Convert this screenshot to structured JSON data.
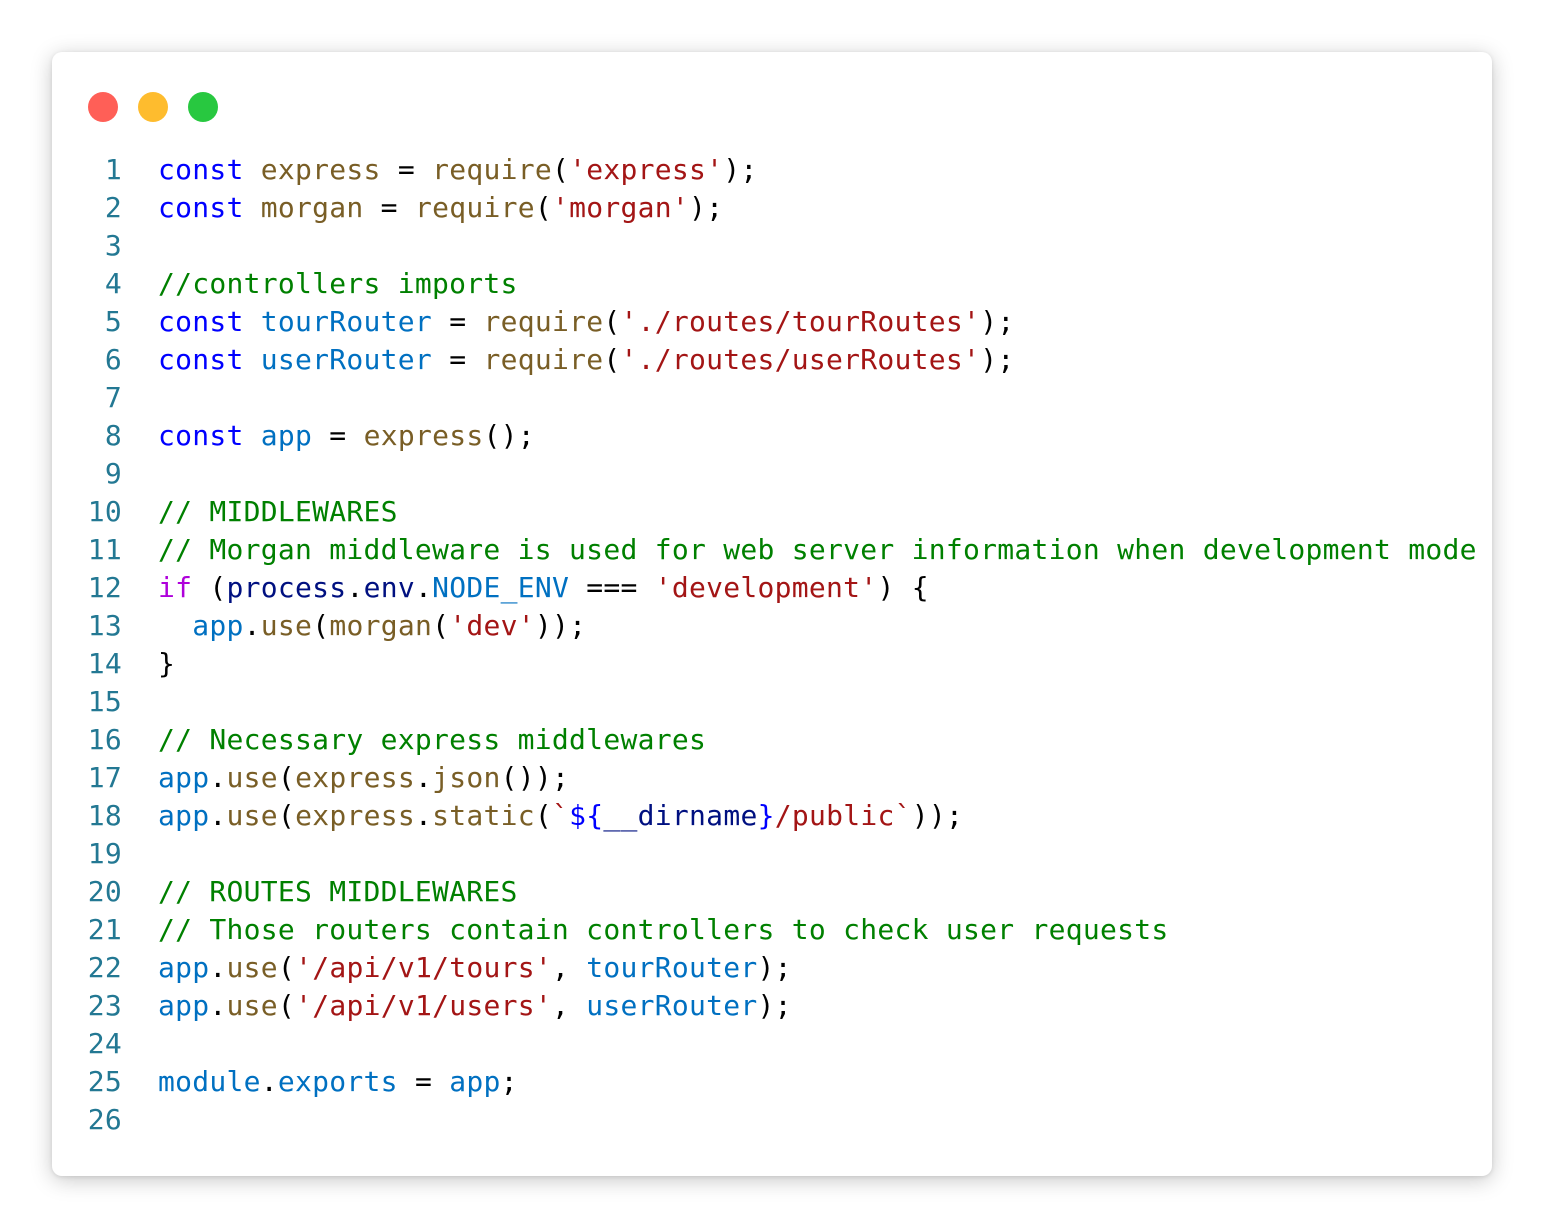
{
  "window": {
    "controls": {
      "close_color": "#ff5f57",
      "minimize_color": "#febc2e",
      "maximize_color": "#28c840"
    }
  },
  "editor": {
    "language": "javascript",
    "colors": {
      "line_number": "#237893",
      "keyword": "#0000ff",
      "control": "#af00db",
      "function": "#795e26",
      "string": "#a31515",
      "variable": "#001080",
      "identifier": "#0070c1",
      "comment": "#008000"
    },
    "lines": [
      {
        "number": "1",
        "tokens": [
          [
            "kw",
            "const"
          ],
          [
            "punc",
            " "
          ],
          [
            "fn",
            "express"
          ],
          [
            "punc",
            " = "
          ],
          [
            "fn",
            "require"
          ],
          [
            "punc",
            "("
          ],
          [
            "str",
            "'express'"
          ],
          [
            "punc",
            ");"
          ]
        ]
      },
      {
        "number": "2",
        "tokens": [
          [
            "kw",
            "const"
          ],
          [
            "punc",
            " "
          ],
          [
            "fn",
            "morgan"
          ],
          [
            "punc",
            " = "
          ],
          [
            "fn",
            "require"
          ],
          [
            "punc",
            "("
          ],
          [
            "str",
            "'morgan'"
          ],
          [
            "punc",
            ");"
          ]
        ]
      },
      {
        "number": "3",
        "tokens": []
      },
      {
        "number": "4",
        "tokens": [
          [
            "cm",
            "//controllers imports"
          ]
        ]
      },
      {
        "number": "5",
        "tokens": [
          [
            "kw",
            "const"
          ],
          [
            "punc",
            " "
          ],
          [
            "id",
            "tourRouter"
          ],
          [
            "punc",
            " = "
          ],
          [
            "fn",
            "require"
          ],
          [
            "punc",
            "("
          ],
          [
            "str",
            "'./routes/tourRoutes'"
          ],
          [
            "punc",
            ");"
          ]
        ]
      },
      {
        "number": "6",
        "tokens": [
          [
            "kw",
            "const"
          ],
          [
            "punc",
            " "
          ],
          [
            "id",
            "userRouter"
          ],
          [
            "punc",
            " = "
          ],
          [
            "fn",
            "require"
          ],
          [
            "punc",
            "("
          ],
          [
            "str",
            "'./routes/userRoutes'"
          ],
          [
            "punc",
            ");"
          ]
        ]
      },
      {
        "number": "7",
        "tokens": []
      },
      {
        "number": "8",
        "tokens": [
          [
            "kw",
            "const"
          ],
          [
            "punc",
            " "
          ],
          [
            "id",
            "app"
          ],
          [
            "punc",
            " = "
          ],
          [
            "fn",
            "express"
          ],
          [
            "punc",
            "();"
          ]
        ]
      },
      {
        "number": "9",
        "tokens": []
      },
      {
        "number": "10",
        "tokens": [
          [
            "cm",
            "// MIDDLEWARES"
          ]
        ]
      },
      {
        "number": "11",
        "tokens": [
          [
            "cm",
            "// Morgan middleware is used for web server information when development mode"
          ]
        ]
      },
      {
        "number": "12",
        "tokens": [
          [
            "ctl",
            "if"
          ],
          [
            "punc",
            " ("
          ],
          [
            "var",
            "process"
          ],
          [
            "punc",
            "."
          ],
          [
            "var",
            "env"
          ],
          [
            "punc",
            "."
          ],
          [
            "id",
            "NODE_ENV"
          ],
          [
            "punc",
            " === "
          ],
          [
            "str",
            "'development'"
          ],
          [
            "punc",
            ") {"
          ]
        ]
      },
      {
        "number": "13",
        "tokens": [
          [
            "punc",
            "  "
          ],
          [
            "id",
            "app"
          ],
          [
            "punc",
            "."
          ],
          [
            "fn",
            "use"
          ],
          [
            "punc",
            "("
          ],
          [
            "fn",
            "morgan"
          ],
          [
            "punc",
            "("
          ],
          [
            "str",
            "'dev'"
          ],
          [
            "punc",
            "));"
          ]
        ]
      },
      {
        "number": "14",
        "tokens": [
          [
            "punc",
            "}"
          ]
        ]
      },
      {
        "number": "15",
        "tokens": []
      },
      {
        "number": "16",
        "tokens": [
          [
            "cm",
            "// Necessary express middlewares"
          ]
        ]
      },
      {
        "number": "17",
        "tokens": [
          [
            "id",
            "app"
          ],
          [
            "punc",
            "."
          ],
          [
            "fn",
            "use"
          ],
          [
            "punc",
            "("
          ],
          [
            "fn",
            "express"
          ],
          [
            "punc",
            "."
          ],
          [
            "fn",
            "json"
          ],
          [
            "punc",
            "());"
          ]
        ]
      },
      {
        "number": "18",
        "tokens": [
          [
            "id",
            "app"
          ],
          [
            "punc",
            "."
          ],
          [
            "fn",
            "use"
          ],
          [
            "punc",
            "("
          ],
          [
            "fn",
            "express"
          ],
          [
            "punc",
            "."
          ],
          [
            "fn",
            "static"
          ],
          [
            "punc",
            "("
          ],
          [
            "str",
            "`"
          ],
          [
            "kw",
            "${"
          ],
          [
            "var",
            "__dirname"
          ],
          [
            "kw",
            "}"
          ],
          [
            "str",
            "/public`"
          ],
          [
            "punc",
            "));"
          ]
        ]
      },
      {
        "number": "19",
        "tokens": []
      },
      {
        "number": "20",
        "tokens": [
          [
            "cm",
            "// ROUTES MIDDLEWARES"
          ]
        ]
      },
      {
        "number": "21",
        "tokens": [
          [
            "cm",
            "// Those routers contain controllers to check user requests"
          ]
        ]
      },
      {
        "number": "22",
        "tokens": [
          [
            "id",
            "app"
          ],
          [
            "punc",
            "."
          ],
          [
            "fn",
            "use"
          ],
          [
            "punc",
            "("
          ],
          [
            "str",
            "'/api/v1/tours'"
          ],
          [
            "punc",
            ", "
          ],
          [
            "id",
            "tourRouter"
          ],
          [
            "punc",
            ");"
          ]
        ]
      },
      {
        "number": "23",
        "tokens": [
          [
            "id",
            "app"
          ],
          [
            "punc",
            "."
          ],
          [
            "fn",
            "use"
          ],
          [
            "punc",
            "("
          ],
          [
            "str",
            "'/api/v1/users'"
          ],
          [
            "punc",
            ", "
          ],
          [
            "id",
            "userRouter"
          ],
          [
            "punc",
            ");"
          ]
        ]
      },
      {
        "number": "24",
        "tokens": []
      },
      {
        "number": "25",
        "tokens": [
          [
            "id",
            "module"
          ],
          [
            "punc",
            "."
          ],
          [
            "id",
            "exports"
          ],
          [
            "punc",
            " = "
          ],
          [
            "id",
            "app"
          ],
          [
            "punc",
            ";"
          ]
        ]
      },
      {
        "number": "26",
        "tokens": []
      }
    ]
  }
}
